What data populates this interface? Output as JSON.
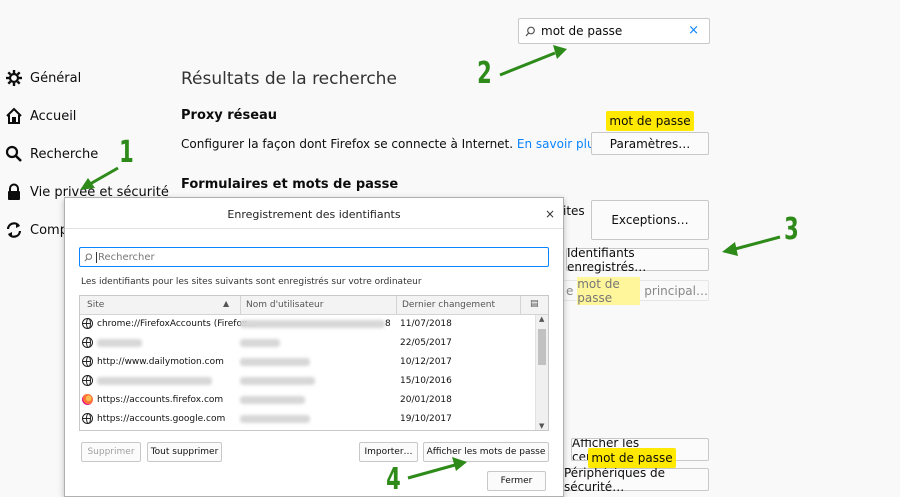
{
  "search": {
    "value": "mot de passe",
    "clear": "×"
  },
  "sidebar": {
    "items": [
      {
        "label": "Général"
      },
      {
        "label": "Accueil"
      },
      {
        "label": "Recherche"
      },
      {
        "label": "Vie privée et sécurité"
      },
      {
        "label": "Comp"
      }
    ]
  },
  "main": {
    "heading": "Résultats de la recherche",
    "proxy_title": "Proxy réseau",
    "proxy_desc": "Configurer la façon dont Firefox se connecte à Internet.",
    "learn_more": "En savoir plus",
    "params_button": "Paramètres…",
    "highlight_text": "mot de passe",
    "forms_title": "Formulaires et mots de passe",
    "sites_text": "ites",
    "exceptions_button": "Exceptions…",
    "saved_logins_button": "Identifiants enregistrés…",
    "master_prefix": "e",
    "master_highlight": "mot de passe",
    "master_suffix": "principal…",
    "certs_button": "Afficher les certificats…",
    "devices_button": "Périphériques de sécurité…",
    "devices_highlight": "mot de passe"
  },
  "dialog": {
    "title": "Enregistrement des identifiants",
    "close": "×",
    "search_placeholder": "Rechercher",
    "description": "Les identifiants pour les sites suivants sont enregistrés sur votre ordinateur",
    "columns": {
      "site": "Site",
      "user": "Nom d'utilisateur",
      "date": "Dernier changement"
    },
    "rows": [
      {
        "site": "chrome://FirefoxAccounts (Firefox…",
        "user_suffix": "8",
        "date": "11/07/2018",
        "icon": "globe-icon"
      },
      {
        "site": "",
        "user_suffix": "",
        "date": "22/05/2017",
        "icon": "globe-icon"
      },
      {
        "site": "http://www.dailymotion.com",
        "user_suffix": "",
        "date": "10/12/2017",
        "icon": "globe-icon"
      },
      {
        "site": "",
        "user_suffix": "",
        "date": "15/10/2016",
        "icon": "globe-icon"
      },
      {
        "site": "https://accounts.firefox.com",
        "user_suffix": "",
        "date": "20/01/2018",
        "icon": "firefox-icon"
      },
      {
        "site": "https://accounts.google.com",
        "user_suffix": "",
        "date": "19/10/2017",
        "icon": "globe-icon"
      }
    ],
    "buttons": {
      "delete": "Supprimer",
      "delete_all": "Tout supprimer",
      "import": "Importer…",
      "show_passwords": "Afficher les mots de passe",
      "close": "Fermer"
    }
  },
  "annotations": [
    "1",
    "2",
    "3",
    "4"
  ]
}
